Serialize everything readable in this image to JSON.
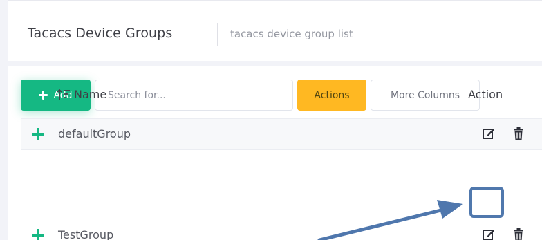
{
  "header": {
    "title": "Tacacs Device Groups",
    "subtitle": "tacacs device group list"
  },
  "toolbar": {
    "add_label": "Add",
    "search_placeholder": "Search for...",
    "actions_label": "Actions",
    "more_columns_label": "More Columns"
  },
  "table": {
    "columns": {
      "name": "Name",
      "action": "Action"
    },
    "rows": [
      {
        "name": "defaultGroup"
      },
      {
        "name": "TestGroup"
      }
    ]
  },
  "colors": {
    "add_button": "#15b883",
    "actions_button": "#ffb822",
    "highlight": "#5078ad",
    "annotation_arrow": "#4f77ad"
  },
  "icons": {
    "add": "plus-icon",
    "sort": "sort-icon",
    "expand": "plus-icon",
    "edit": "edit-icon",
    "delete": "trash-icon"
  }
}
